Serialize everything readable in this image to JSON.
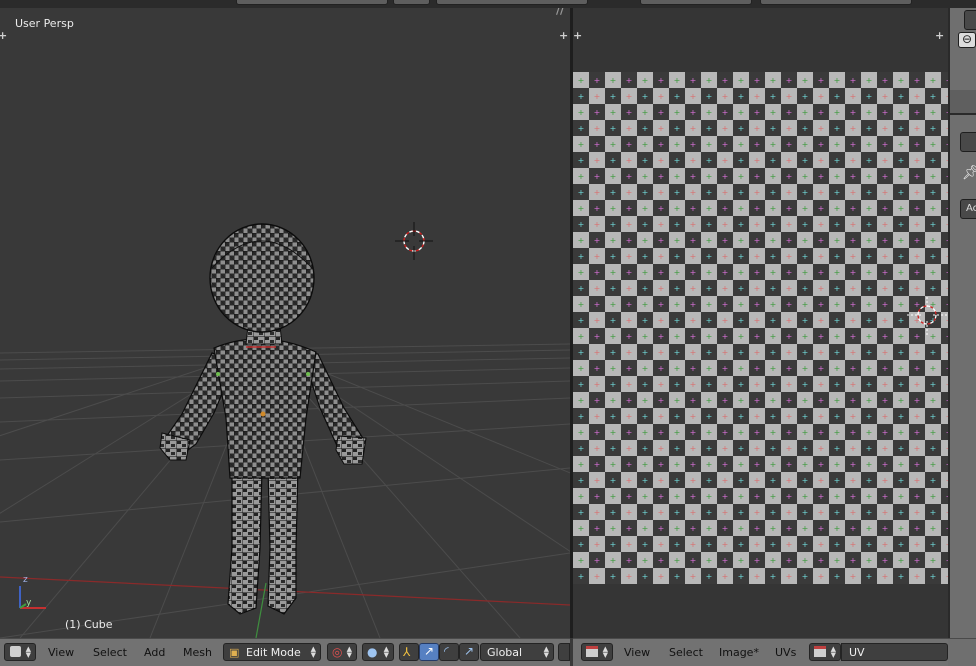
{
  "viewport3d": {
    "view_label": "User Persp",
    "object_label": "(1) Cube",
    "axes": {
      "z": "z",
      "y": "y"
    },
    "header": {
      "menus": [
        "View",
        "Select",
        "Add",
        "Mesh"
      ],
      "mode": "Edit Mode",
      "orientation": "Global"
    }
  },
  "uv_editor": {
    "header": {
      "menus": [
        "View",
        "Select",
        "Image*",
        "UVs"
      ],
      "map_name": "UV"
    }
  },
  "right_panel": {
    "partial_label": "Ac"
  },
  "icons": {
    "viewport_type": "cube-icon",
    "mode": "edit-mode-icon",
    "pivot": "pivot-icon",
    "shading": "shading-icon",
    "manipulator": "manipulator-icon",
    "translate": "translate-arrow-icon",
    "rotate": "rotate-icon",
    "scale": "scale-icon",
    "image_editor": "image-editor-icon",
    "uv_map": "uv-map-icon",
    "pin": "pin-icon"
  },
  "colors": {
    "header_bg": "#727272",
    "viewport_bg": "#393939",
    "x_axis": "#b03030",
    "y_axis": "#3f9d3f",
    "z_axis": "#3f62c4",
    "active_toggle": "#5680c2"
  }
}
